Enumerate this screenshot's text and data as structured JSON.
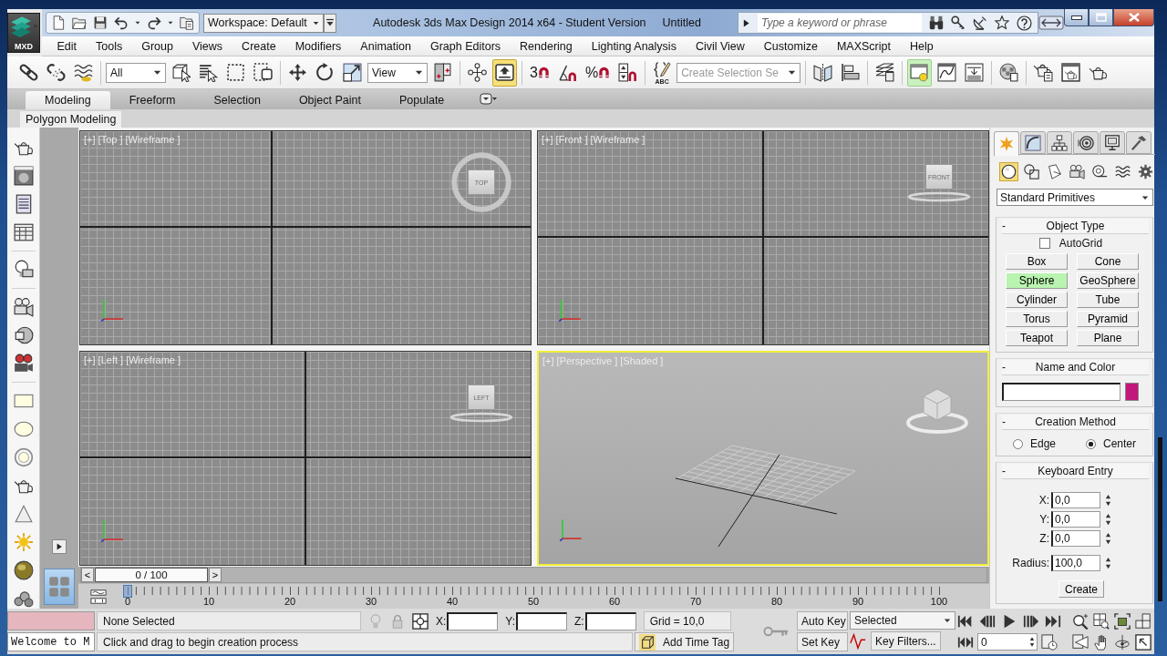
{
  "title_bar": {
    "app_badge": "MXD",
    "workspace": "Workspace: Default",
    "title": "Autodesk 3ds Max Design 2014 x64  - Student Version",
    "document": "Untitled",
    "search": {
      "placeholder": "Type a keyword or phrase"
    }
  },
  "menu_bar": [
    "Edit",
    "Tools",
    "Group",
    "Views",
    "Create",
    "Modifiers",
    "Animation",
    "Graph Editors",
    "Rendering",
    "Lighting Analysis",
    "Civil View",
    "Customize",
    "MAXScript",
    "Help"
  ],
  "main_toolbar": [
    {
      "kind": "chain",
      "on": false,
      "open": false
    },
    {
      "kind": "broken-chain",
      "on": false,
      "open": false
    },
    {
      "kind": "waves",
      "on": false,
      "open": false
    },
    {
      "kind": "separator"
    },
    {
      "kind": "dropdown",
      "value": "All"
    },
    {
      "kind": "cube-cursor",
      "on": false,
      "open": false
    },
    {
      "kind": "list-cursor",
      "on": false,
      "open": false
    },
    {
      "kind": "dashed-rectangle",
      "on": false,
      "open": false
    },
    {
      "kind": "dashed-squares",
      "on": false,
      "open": false
    },
    {
      "kind": "separator"
    },
    {
      "kind": "move",
      "on": false,
      "open": false
    },
    {
      "kind": "rotate",
      "on": false,
      "open": false
    },
    {
      "kind": "scale",
      "on": false,
      "open": false
    },
    {
      "kind": "dropdown",
      "value": "View"
    },
    {
      "kind": "pivot",
      "on": false,
      "open": false
    },
    {
      "kind": "separator"
    },
    {
      "kind": "nodes",
      "on": false,
      "open": false
    },
    {
      "kind": "up-arrow",
      "on": true,
      "open": false
    },
    {
      "kind": "separator"
    },
    {
      "kind": "snap",
      "label": "3",
      "on": false,
      "open": false
    },
    {
      "kind": "angle-snap",
      "on": false,
      "open": false
    },
    {
      "kind": "snap",
      "label": "%",
      "on": false,
      "open": false
    },
    {
      "kind": "spinner-snap",
      "on": false,
      "open": false
    },
    {
      "kind": "separator"
    },
    {
      "kind": "braces",
      "caption": "ABC",
      "on": false,
      "open": false
    },
    {
      "kind": "combo",
      "placeholder": "Create Selection Se"
    },
    {
      "kind": "separator"
    },
    {
      "kind": "mirror",
      "on": false,
      "open": false
    },
    {
      "kind": "align",
      "on": false,
      "open": false
    },
    {
      "kind": "separator"
    },
    {
      "kind": "layers",
      "on": false,
      "open": false
    },
    {
      "kind": "separator"
    },
    {
      "kind": "explorer",
      "on": false,
      "open": true
    },
    {
      "kind": "curve-editor",
      "on": false,
      "open": false
    },
    {
      "kind": "schematic",
      "on": false,
      "open": false
    },
    {
      "kind": "separator"
    },
    {
      "kind": "material",
      "on": false,
      "open": false
    },
    {
      "kind": "separator"
    },
    {
      "kind": "render-setup",
      "on": false,
      "open": false
    },
    {
      "kind": "frame-window",
      "on": false,
      "open": false
    },
    {
      "kind": "teapot",
      "on": false,
      "open": false
    }
  ],
  "ribbon": {
    "tabs": [
      {
        "label": "Modeling",
        "selected": true
      },
      {
        "label": "Freeform",
        "selected": false
      },
      {
        "label": "Selection",
        "selected": false
      },
      {
        "label": "Object Paint",
        "selected": false
      },
      {
        "label": "Populate",
        "selected": false
      }
    ],
    "panel": "Polygon Modeling"
  },
  "viewports": [
    {
      "kind": "plan",
      "label": "[+] [Top ] [Wireframe ]",
      "viewcube": "TOP",
      "selected": false
    },
    {
      "kind": "elevation",
      "label": "[+] [Front ] [Wireframe ]",
      "viewcube": "FRONT",
      "selected": false
    },
    {
      "kind": "elevation",
      "label": "[+] [Left ] [Wireframe ]",
      "viewcube": "LEFT",
      "selected": false
    },
    {
      "kind": "perspective",
      "label": "[+] [Perspective ] [Shaded ]",
      "selected": true
    }
  ],
  "time_slider": {
    "previous": "<",
    "position": "0 / 100",
    "next": ">",
    "level": 0
  },
  "track_bar": {
    "ticks": [
      "0",
      "10",
      "20",
      "30",
      "40",
      "50",
      "60",
      "70",
      "80",
      "90",
      "100"
    ]
  },
  "command_panel": {
    "tabs": [
      {
        "kind": "create",
        "selected": true
      },
      {
        "kind": "modify",
        "selected": false
      },
      {
        "kind": "hierarchy",
        "selected": false
      },
      {
        "kind": "motion",
        "selected": false
      },
      {
        "kind": "display",
        "selected": false
      },
      {
        "kind": "utilities",
        "selected": false
      }
    ],
    "categories": [
      {
        "kind": "geometry",
        "selected": true
      },
      {
        "kind": "shapes",
        "selected": false
      },
      {
        "kind": "lights",
        "selected": false
      },
      {
        "kind": "cameras",
        "selected": false
      },
      {
        "kind": "helpers",
        "selected": false
      },
      {
        "kind": "space-warps",
        "selected": false
      },
      {
        "kind": "systems",
        "selected": false
      }
    ],
    "type": "Standard Primitives",
    "rollouts": [
      {
        "kind": "object-type",
        "toggle": "-",
        "title": "Object Type",
        "autogrid": {
          "label": "AutoGrid",
          "checked": false
        },
        "buttons": [
          {
            "label": "Box",
            "selected": false
          },
          {
            "label": "Cone",
            "selected": false
          },
          {
            "label": "Sphere",
            "selected": true
          },
          {
            "label": "GeoSphere",
            "selected": false
          },
          {
            "label": "Cylinder",
            "selected": false
          },
          {
            "label": "Tube",
            "selected": false
          },
          {
            "label": "Torus",
            "selected": false
          },
          {
            "label": "Pyramid",
            "selected": false
          },
          {
            "label": "Teapot",
            "selected": false
          },
          {
            "label": "Plane",
            "selected": false
          }
        ]
      },
      {
        "kind": "name-color",
        "toggle": "-",
        "title": "Name and Color",
        "color": "#c2177d"
      },
      {
        "kind": "creation-method",
        "toggle": "-",
        "title": "Creation Method",
        "options": [
          {
            "label": "Edge",
            "selected": false
          },
          {
            "label": "Center",
            "selected": true
          }
        ]
      },
      {
        "kind": "keyboard-entry",
        "toggle": "-",
        "title": "Keyboard Entry",
        "fields": [
          {
            "kind": "coordinate",
            "label": "X:",
            "value": "0,0"
          },
          {
            "kind": "coordinate",
            "label": "Y:",
            "value": "0,0"
          },
          {
            "kind": "coordinate",
            "label": "Z:",
            "value": "0,0"
          },
          {
            "kind": "parameter",
            "label": "Radius:",
            "value": "100,0"
          }
        ],
        "action": "Create"
      }
    ]
  },
  "status_bar": {
    "listener": "Welcome to M",
    "selection": "None Selected",
    "prompt": "Click and drag to begin creation process",
    "coordinates": [
      "X:",
      "Y:",
      "Z:"
    ],
    "grid": "Grid = 10,0",
    "time_tag": "Add Time Tag",
    "auto_key": {
      "label": "Auto Key",
      "on": false
    },
    "key_filter": "Selected",
    "set_key": "Set Key",
    "key_filters": "Key Filters...",
    "frame": "0"
  }
}
